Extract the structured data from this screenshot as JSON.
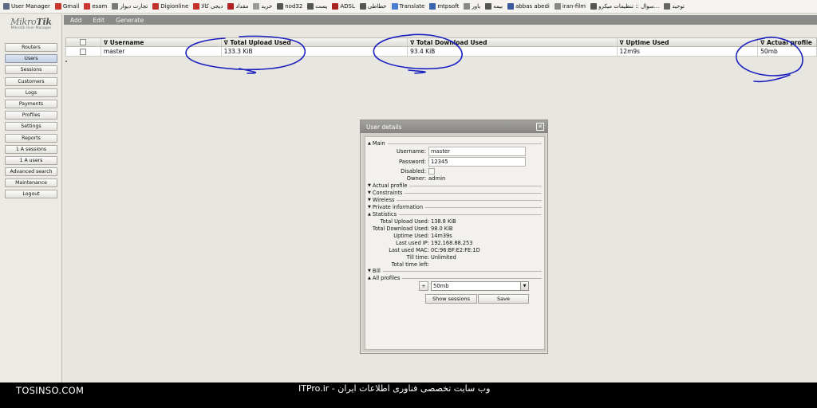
{
  "bookmarks": [
    {
      "label": "User Manager",
      "icon": "mikrotik-icon",
      "color": "#5b6b84"
    },
    {
      "label": "Gmail",
      "icon": "gmail-icon",
      "color": "#c8362b"
    },
    {
      "label": "esam",
      "icon": "bookmark-icon",
      "color": "#cc3333"
    },
    {
      "label": "تجارت دیوار",
      "icon": "bookmark-icon",
      "color": "#777777"
    },
    {
      "label": "Digionline",
      "icon": "digikala-icon",
      "color": "#c4302b"
    },
    {
      "label": "دیجی کالا",
      "icon": "digikala-icon",
      "color": "#c4302b"
    },
    {
      "label": "مقداد",
      "icon": "bookmark-icon",
      "color": "#b22222"
    },
    {
      "label": "خرید",
      "icon": "bookmark-icon",
      "color": "#999999"
    },
    {
      "label": "nod32",
      "icon": "globe-icon",
      "color": "#555555"
    },
    {
      "label": "پست",
      "icon": "globe-icon",
      "color": "#555555"
    },
    {
      "label": "ADSL",
      "icon": "tools-icon",
      "color": "#aa2222"
    },
    {
      "label": "خطاطی",
      "icon": "globe-icon",
      "color": "#555555"
    },
    {
      "label": "Translate",
      "icon": "translate-icon",
      "color": "#4a7bd0"
    },
    {
      "label": "mtpsoft",
      "icon": "arrow-icon",
      "color": "#3a62a8"
    },
    {
      "label": "باور",
      "icon": "bookmark-icon",
      "color": "#888888"
    },
    {
      "label": "بیمه",
      "icon": "globe-icon",
      "color": "#555555"
    },
    {
      "label": "abbas abedi",
      "icon": "folder-icon",
      "color": "#3b5998"
    },
    {
      "label": "iran-film",
      "icon": "folder-icon",
      "color": "#888888"
    },
    {
      "label": "سوال :: تنظیمات میکرو...",
      "icon": "pen-icon",
      "color": "#555555"
    },
    {
      "label": "توحید",
      "icon": "bookmark-icon",
      "color": "#666666"
    }
  ],
  "logo": {
    "brand_light": "Mikro",
    "brand_bold": "Tik",
    "subtitle": "Mikrotik User Manager"
  },
  "nav": [
    {
      "label": "Routers",
      "active": false
    },
    {
      "label": "Users",
      "active": true
    },
    {
      "label": "Sessions",
      "active": false
    },
    {
      "label": "Customers",
      "active": false
    },
    {
      "label": "Logs",
      "active": false
    },
    {
      "label": "Payments",
      "active": false
    },
    {
      "label": "Profiles",
      "active": false
    },
    {
      "label": "Settings",
      "active": false
    },
    {
      "label": "Reports",
      "active": false
    },
    {
      "label": "1 A sessions",
      "active": false
    },
    {
      "label": "1 A users",
      "active": false
    },
    {
      "label": "Advanced search",
      "active": false
    },
    {
      "label": "Maintenance",
      "active": false
    },
    {
      "label": "Logout",
      "active": false
    }
  ],
  "menubar": {
    "add": "Add",
    "edit": "Edit",
    "generate": "Generate"
  },
  "table": {
    "headers": [
      "∇ Username",
      "∇ Total Upload Used",
      "∇ Total Download Used",
      "∇ Uptime Used",
      "∇ Actual profile"
    ],
    "rows": [
      {
        "username": "master",
        "upload": "133.3 KiB",
        "download": "93.4 KiB",
        "uptime": "12m9s",
        "profile": "50mb"
      }
    ]
  },
  "dialog": {
    "title": "User details",
    "close": "✕",
    "sections": {
      "main": "Main",
      "actual_profile": "Actual profile",
      "constraints": "Constraints",
      "wireless": "Wireless",
      "private_information": "Private information",
      "statistics": "Statistics",
      "bill": "Bill",
      "all_profiles": "All profiles"
    },
    "main": {
      "username_label": "Username:",
      "username_value": "master",
      "password_label": "Password:",
      "password_value": "12345",
      "disabled_label": "Disabled:",
      "owner_label": "Owner:",
      "owner_value": "admin"
    },
    "statistics": [
      {
        "label": "Total Upload Used:",
        "value": "138.8 KiB"
      },
      {
        "label": "Total Download Used:",
        "value": "98.0 KiB"
      },
      {
        "label": "Uptime Used:",
        "value": "14m39s"
      },
      {
        "label": "Last used IP:",
        "value": "192.168.88.253"
      },
      {
        "label": "Last used MAC:",
        "value": "0C:96:BF:E2:FE:1D"
      },
      {
        "label": "Till time:",
        "value": "Unlimited"
      },
      {
        "label": "Total time left:",
        "value": ""
      }
    ],
    "profiles": {
      "add": "+",
      "selected": "50mb",
      "show_sessions": "Show sessions",
      "save": "Save"
    }
  },
  "footer": {
    "left": "TOSINSO.COM",
    "center": "وب سایت تخصصی فناوری اطلاعات ایران - ITPro.ir"
  },
  "colors": {
    "annotation": "#1a1fbf",
    "menubar": "#8a8a88",
    "dialog_title": "#8a8985"
  }
}
